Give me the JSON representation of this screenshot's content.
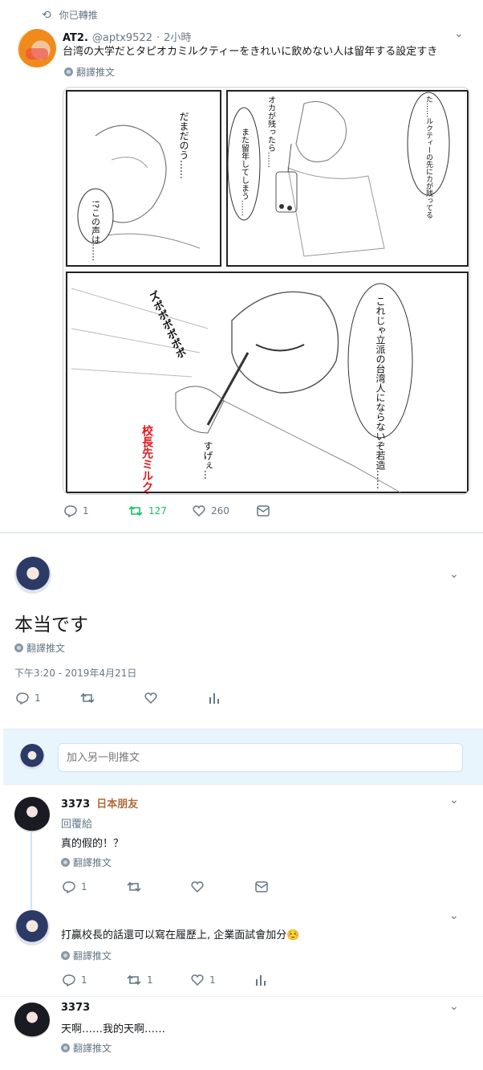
{
  "quoted": {
    "retweet_label": "你已轉推",
    "name": "AT2.",
    "handle": "@aptx9522",
    "dot": "·",
    "time": "2小時",
    "text": "台湾の大学だとタピオカミルクティーをきれいに飲めない人は留年する設定すき",
    "translate": "翻譯推文",
    "image_text": {
      "panel1_a": "だまだのう……",
      "panel1_b": "!?この声は……",
      "panel2_a": "オカが残ったら……",
      "panel2_b": "また留年してしまう……",
      "panel2_c": "た……ルクティーの先にカが残ってる",
      "panel3_a": "ズボボボボボボ",
      "panel3_b": "これじゃ立派の台湾人にならないぞ若造……",
      "panel3_c": "すげぇ…",
      "panel3_d": "校長先ミルクタピオク"
    },
    "replies": "1",
    "retweets": "127",
    "likes": "260",
    "retweet_color": "#17bf63"
  },
  "main": {
    "text": "本当です",
    "translate": "翻譯推文",
    "timestamp": "下午3:20 - 2019年4月21日",
    "replies": "1"
  },
  "compose": {
    "placeholder": "加入另一則推文"
  },
  "replies": [
    {
      "name": "3373",
      "badge": "日本朋友",
      "reply_to": "回覆給",
      "text": "真的假的！？",
      "translate": "翻譯推文",
      "replies": "1"
    },
    {
      "text": "打贏校長的話還可以寫在履歷上, 企業面試會加分☺️",
      "translate": "翻譯推文",
      "replies": "1",
      "retweets": "1",
      "likes": "1"
    },
    {
      "name": "3373",
      "text": "天啊……我的天啊……",
      "translate": "翻譯推文"
    }
  ]
}
